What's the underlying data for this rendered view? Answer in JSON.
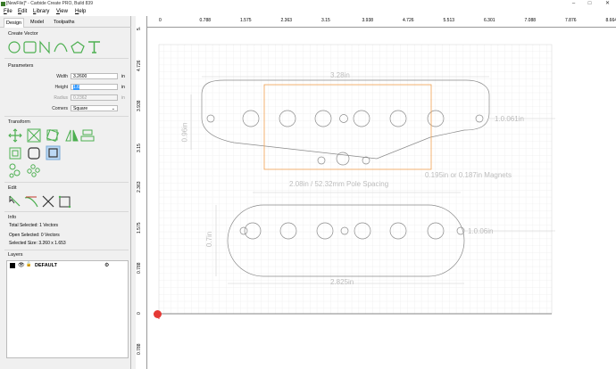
{
  "window": {
    "title": "[NewFile]* - Carbide Create PRO, Build 839",
    "minimize": "–",
    "maximize": "□",
    "close": "✕"
  },
  "menu": [
    "File",
    "Edit",
    "Library",
    "View",
    "Help"
  ],
  "tabs": [
    "Design",
    "Model",
    "Toolpaths"
  ],
  "sections": {
    "create_vector": "Create Vector",
    "parameters": "Parameters",
    "transform": "Transform",
    "edit": "Edit",
    "info": "Info",
    "layers": "Layers"
  },
  "parameters": {
    "width_label": "Width",
    "width_value": "3.2600",
    "width_unit": "in",
    "height_label": "Height",
    "height_value": "1.6",
    "height_unit": "in",
    "radius_label": "Radius",
    "radius_value": "0.2362",
    "radius_unit": "in",
    "corners_label": "Corners",
    "corners_value": "Square"
  },
  "info": {
    "total_selected": "Total Selected:   1 Vectors",
    "open_selected": "Open Selected:   0 Vectors",
    "selected_size": "Selected Size:    3.260 x 1.653"
  },
  "layers": [
    {
      "name": "DEFAULT",
      "color": "#000000"
    }
  ],
  "ruler": {
    "h": [
      "0",
      "0.788",
      "1.575",
      "2.363",
      "3.15",
      "3.938",
      "4.726",
      "5.513",
      "6.301",
      "7.088",
      "7.876",
      "8.664"
    ],
    "v": [
      "5.51",
      "4.726",
      "3.938",
      "3.15",
      "2.363",
      "1.575",
      "0.788",
      "0",
      "0.788"
    ]
  },
  "dimensions": {
    "top_width": "3.28in",
    "top_height": "0.96in",
    "top_right": "1.0.061in",
    "pole_spacing": "2.08in / 52.32mm Pole Spacing",
    "magnets": "0.195in or 0.187in Magnets",
    "bottom_height": "0.7in",
    "bottom_right": "1.0.06in",
    "bottom_width": "2.825in"
  },
  "colors": {
    "selection": "#f0a050",
    "grid": "#e6e6e6",
    "vector": "#888888",
    "accent": "#4caf50"
  }
}
